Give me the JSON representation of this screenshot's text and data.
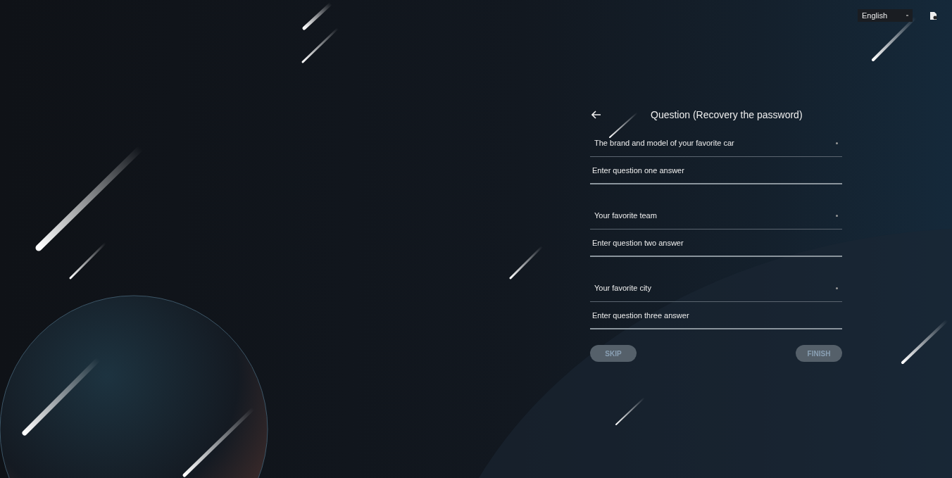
{
  "top_bar": {
    "language": "English"
  },
  "form": {
    "title": "Question (Recovery the password)",
    "questions": [
      {
        "question": "The brand and model of your favorite car",
        "answer_placeholder": "Enter question one answer"
      },
      {
        "question": "Your favorite team",
        "answer_placeholder": "Enter question two answer"
      },
      {
        "question": "Your favorite city",
        "answer_placeholder": "Enter question three answer"
      }
    ],
    "buttons": [
      {
        "label": "SKIP",
        "disabled": true
      },
      {
        "label": "FINISH",
        "disabled": true
      }
    ]
  }
}
